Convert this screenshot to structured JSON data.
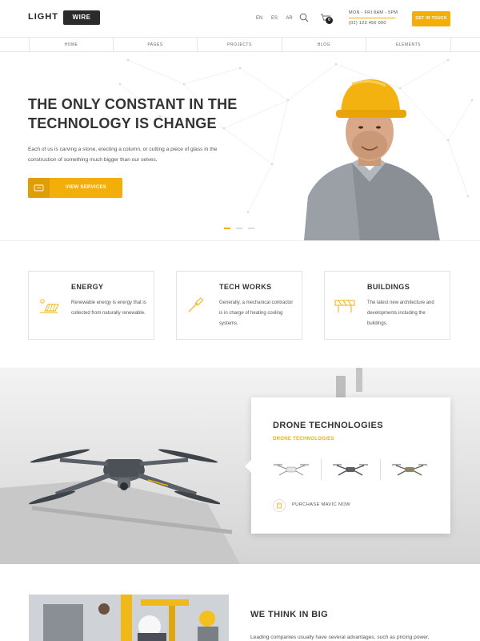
{
  "header": {
    "logo_text": "LIGHT",
    "logo_box": "WIRE",
    "langs": [
      "EN",
      "ES",
      "AR"
    ],
    "cart_count": "0",
    "hours": "MON - FRI 8AM - 5PM",
    "phone": "(02) 123 456 000",
    "cta": "GET IN TOUCH"
  },
  "nav": {
    "items": [
      "HOME",
      "PAGES",
      "PROJECTS",
      "BLOG",
      "ELEMENTS"
    ]
  },
  "hero": {
    "title_line1": "THE ONLY CONSTANT IN THE",
    "title_line2": "TECHNOLOGY IS CHANGE",
    "text": "Each of us is carving a stone, erecting a column, or cutting a piece of glass in the construction of something much bigger than our selves.",
    "button": "VIEW SERVICES",
    "slide_count": 3,
    "active_slide": 1
  },
  "services": [
    {
      "title": "ENERGY",
      "text": "Renewable energy is energy that is collected from naturally renewable.",
      "icon": "solar-panel-icon"
    },
    {
      "title": "TECH WORKS",
      "text": "Generally, a mechanical contractor is in charge of heating cooling systems.",
      "icon": "screwdriver-icon"
    },
    {
      "title": "BUILDINGS",
      "text": "The latest new architecture and developments including the buildings.",
      "icon": "barrier-icon"
    }
  ],
  "drone": {
    "title": "DRONE TECHNOLOGIES",
    "subtitle": "DRONE TECHNOLOGIES",
    "purchase": "PURCHASE MAVIC NOW"
  },
  "bottom": {
    "title": "WE THINK IN BIG",
    "text": "Leading companies usually have several advantages, such as pricing power,"
  },
  "colors": {
    "accent": "#f3ae0a",
    "dark": "#333333"
  }
}
